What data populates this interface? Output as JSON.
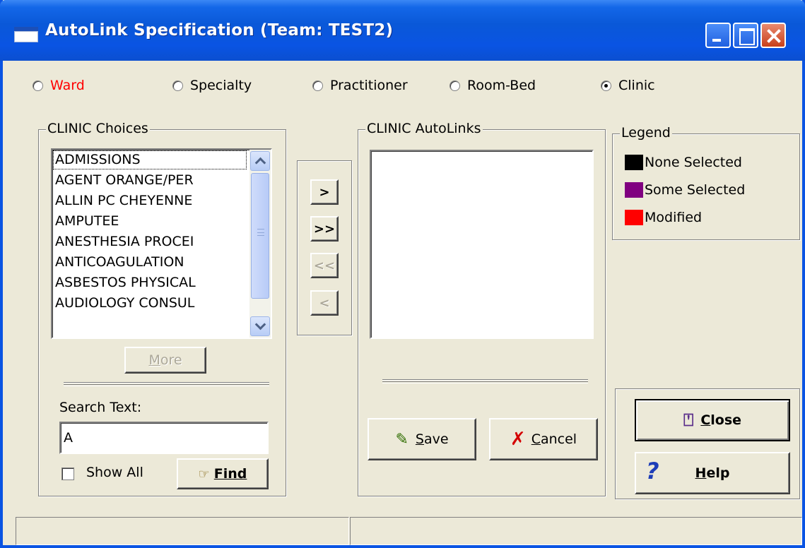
{
  "window": {
    "title": "AutoLink Specification (Team: TEST2)"
  },
  "radios": [
    {
      "label": "Ward",
      "selected": false,
      "color": "#ff0000"
    },
    {
      "label": "Specialty",
      "selected": false
    },
    {
      "label": "Practitioner",
      "selected": false
    },
    {
      "label": "Room-Bed",
      "selected": false
    },
    {
      "label": "Clinic",
      "selected": true
    }
  ],
  "choices": {
    "group_label": "CLINIC Choices",
    "items": [
      "ADMISSIONS",
      "AGENT ORANGE/PER",
      "ALLIN PC CHEYENNE",
      "AMPUTEE",
      "ANESTHESIA PROCEI",
      "ANTICOAGULATION",
      "ASBESTOS PHYSICAL",
      "AUDIOLOGY CONSUL"
    ],
    "more_label": "More",
    "search_label": "Search Text:",
    "search_value": "A",
    "show_all_label": "Show All",
    "show_all_checked": false,
    "find_label": "Find"
  },
  "transfer": {
    "add_one": ">",
    "add_all": ">>",
    "remove_all": "<<",
    "remove_one": "<"
  },
  "autolinks": {
    "group_label": "CLINIC AutoLinks",
    "items": [],
    "save_label": "Save",
    "cancel_label": "Cancel"
  },
  "legend": {
    "group_label": "Legend",
    "entries": [
      {
        "label": "None Selected",
        "color": "#000000"
      },
      {
        "label": "Some Selected",
        "color": "#800080"
      },
      {
        "label": "Modified",
        "color": "#ff0000"
      }
    ]
  },
  "actions": {
    "close_label": "Close",
    "help_label": "Help"
  },
  "statusbar": {
    "text": ""
  }
}
